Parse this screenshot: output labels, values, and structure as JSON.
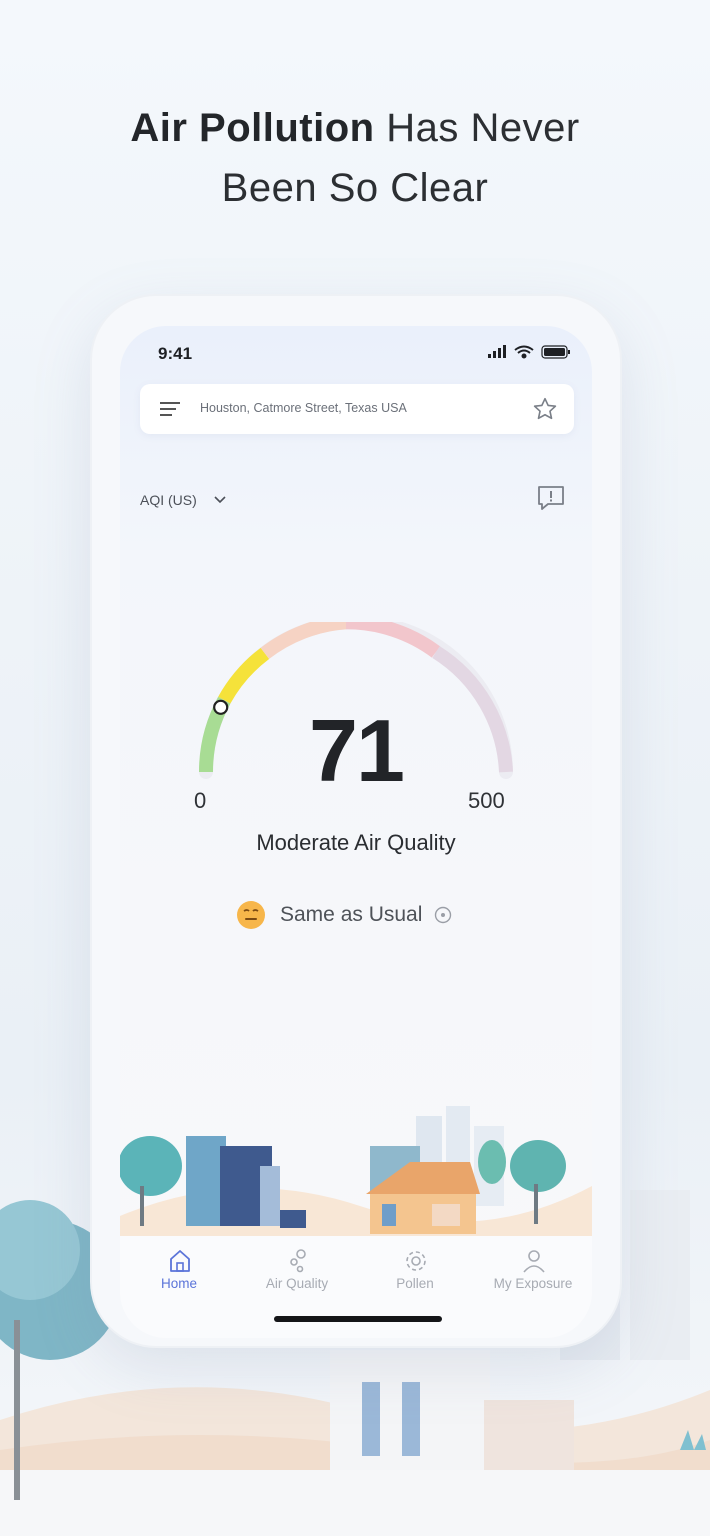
{
  "headline": {
    "bold": "Air Pollution",
    "rest": "Has Never",
    "line2": "Been So Clear"
  },
  "status_bar": {
    "time": "9:41"
  },
  "search": {
    "location": "Houston, Catmore Street, Texas USA"
  },
  "aqi": {
    "standard_label": "AQI (US)",
    "value": "71",
    "min": "0",
    "max": "500",
    "quality": "Moderate Air Quality",
    "comparison": "Same as Usual",
    "level_fraction": 0.142
  },
  "tabs": [
    {
      "label": "Home",
      "icon": "home-icon",
      "active": true
    },
    {
      "label": "Air Quality",
      "icon": "air-quality-icon",
      "active": false
    },
    {
      "label": "Pollen",
      "icon": "pollen-icon",
      "active": false
    },
    {
      "label": "My Exposure",
      "icon": "person-icon",
      "active": false
    }
  ],
  "colors": {
    "accent": "#5b74d9",
    "moderate": "#f5e23a",
    "good": "#a8dc94"
  }
}
